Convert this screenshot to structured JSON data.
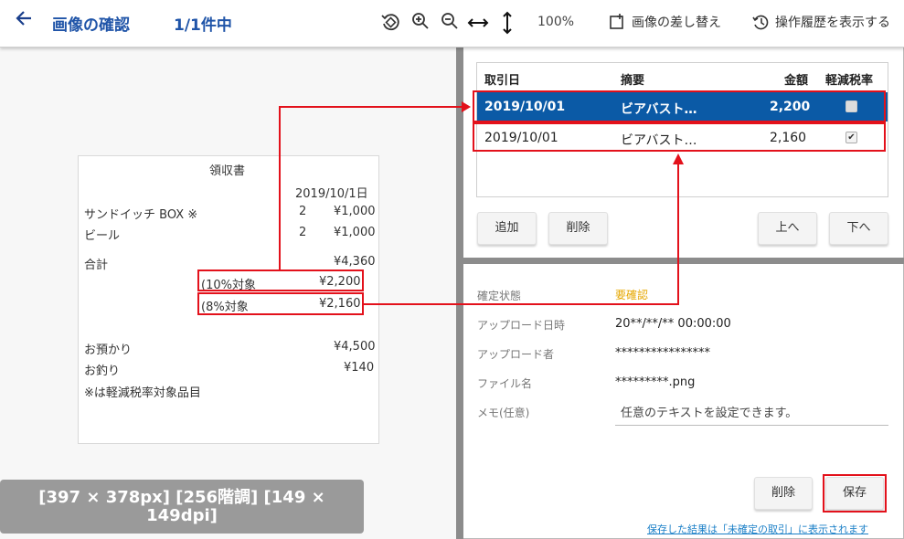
{
  "header": {
    "back_icon": "arrow-left-icon",
    "title": "画像の確認",
    "count": "1/1件中",
    "zoom": "100%",
    "replace_label": "画像の差し替え",
    "history_label": "操作履歴を表示する"
  },
  "receipt": {
    "heading": "領収書",
    "date": "2019/10/1日",
    "items": [
      {
        "name": "サンドイッチ BOX ※",
        "qty": "2",
        "price": "¥1,000"
      },
      {
        "name": "ビール",
        "qty": "2",
        "price": "¥1,000"
      }
    ],
    "total_label": "合計",
    "total_value": "¥4,360",
    "tax10_label": "(10%対象",
    "tax10_value": "¥2,200",
    "tax8_label": "(8%対象",
    "tax8_value": "¥2,160",
    "deposit_label": "お預かり",
    "deposit_value": "¥4,500",
    "change_label": "お釣り",
    "change_value": "¥140",
    "note": "※は軽減税率対象品目"
  },
  "image_info": {
    "line1": "[397 × 378px] [256階調] [149 ×",
    "line2": "149dpi]"
  },
  "table": {
    "headers": {
      "date": "取引日",
      "summary": "摘要",
      "amount": "金額",
      "reduced": "軽減税率"
    },
    "rows": [
      {
        "date": "2019/10/01",
        "summary": "ビアバスト…",
        "amount": "2,200",
        "reduced": false,
        "selected": true
      },
      {
        "date": "2019/10/01",
        "summary": "ビアバスト…",
        "amount": "2,160",
        "reduced": true,
        "selected": false
      }
    ]
  },
  "row_buttons": {
    "add": "追加",
    "delete": "削除",
    "up": "上へ",
    "down": "下へ"
  },
  "details": {
    "status_label": "確定状態",
    "status_value": "要確認",
    "status_color": "#e6a700",
    "upload_date_label": "アップロード日時",
    "upload_date_value": "20**/**/** 00:00:00",
    "uploader_label": "アップロード者",
    "uploader_value": "****************",
    "filename_label": "ファイル名",
    "filename_value": "*********.png",
    "memo_label": "メモ(任意)",
    "memo_placeholder": "任意のテキストを設定できます。"
  },
  "footer": {
    "delete_label": "削除",
    "save_label": "保存",
    "note": "保存した結果は「未確定の取引」に表示されます"
  },
  "colors": {
    "accent": "#1f54a8",
    "selected_row": "#0b5aa6",
    "annotation": "#e3111b",
    "link": "#1a7fc7"
  }
}
